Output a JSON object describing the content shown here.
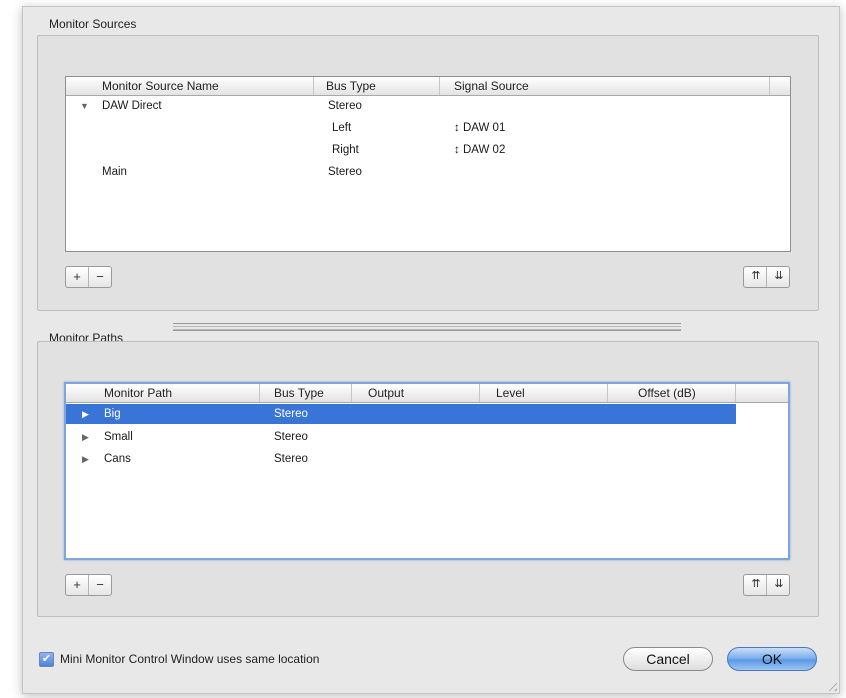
{
  "monitor_sources": {
    "group_title": "Monitor Sources",
    "columns": [
      "Monitor Source Name",
      "Bus Type",
      "Signal Source"
    ],
    "rows": [
      {
        "name": "DAW Direct",
        "bus": "Stereo",
        "signal": "",
        "expanded": true,
        "indent": 0
      },
      {
        "name": "",
        "bus": "Left",
        "signal": "↕ DAW 01",
        "indent": 1
      },
      {
        "name": "",
        "bus": "Right",
        "signal": "↕ DAW 02",
        "indent": 1
      },
      {
        "name": "Main",
        "bus": "Stereo",
        "signal": "",
        "indent": 0
      }
    ],
    "add_label": "+",
    "remove_label": "−",
    "move_up_label": "⇈",
    "move_down_label": "⇊"
  },
  "monitor_paths": {
    "group_title": "Monitor Paths",
    "columns": [
      "Monitor Path",
      "Bus Type",
      "Output",
      "Level",
      "Offset (dB)"
    ],
    "rows": [
      {
        "name": "Big",
        "bus": "Stereo",
        "selected": true
      },
      {
        "name": "Small",
        "bus": "Stereo",
        "selected": false
      },
      {
        "name": "Cans",
        "bus": "Stereo",
        "selected": false
      }
    ],
    "add_label": "+",
    "remove_label": "−",
    "move_up_label": "⇈",
    "move_down_label": "⇊"
  },
  "mini_monitor": {
    "label": "Mini Monitor Control Window uses same location",
    "checked": true,
    "check_glyph": "✔"
  },
  "buttons": {
    "cancel": "Cancel",
    "ok": "OK"
  },
  "colors": {
    "selection": "#3875d7",
    "accent": "#5b98e6"
  }
}
